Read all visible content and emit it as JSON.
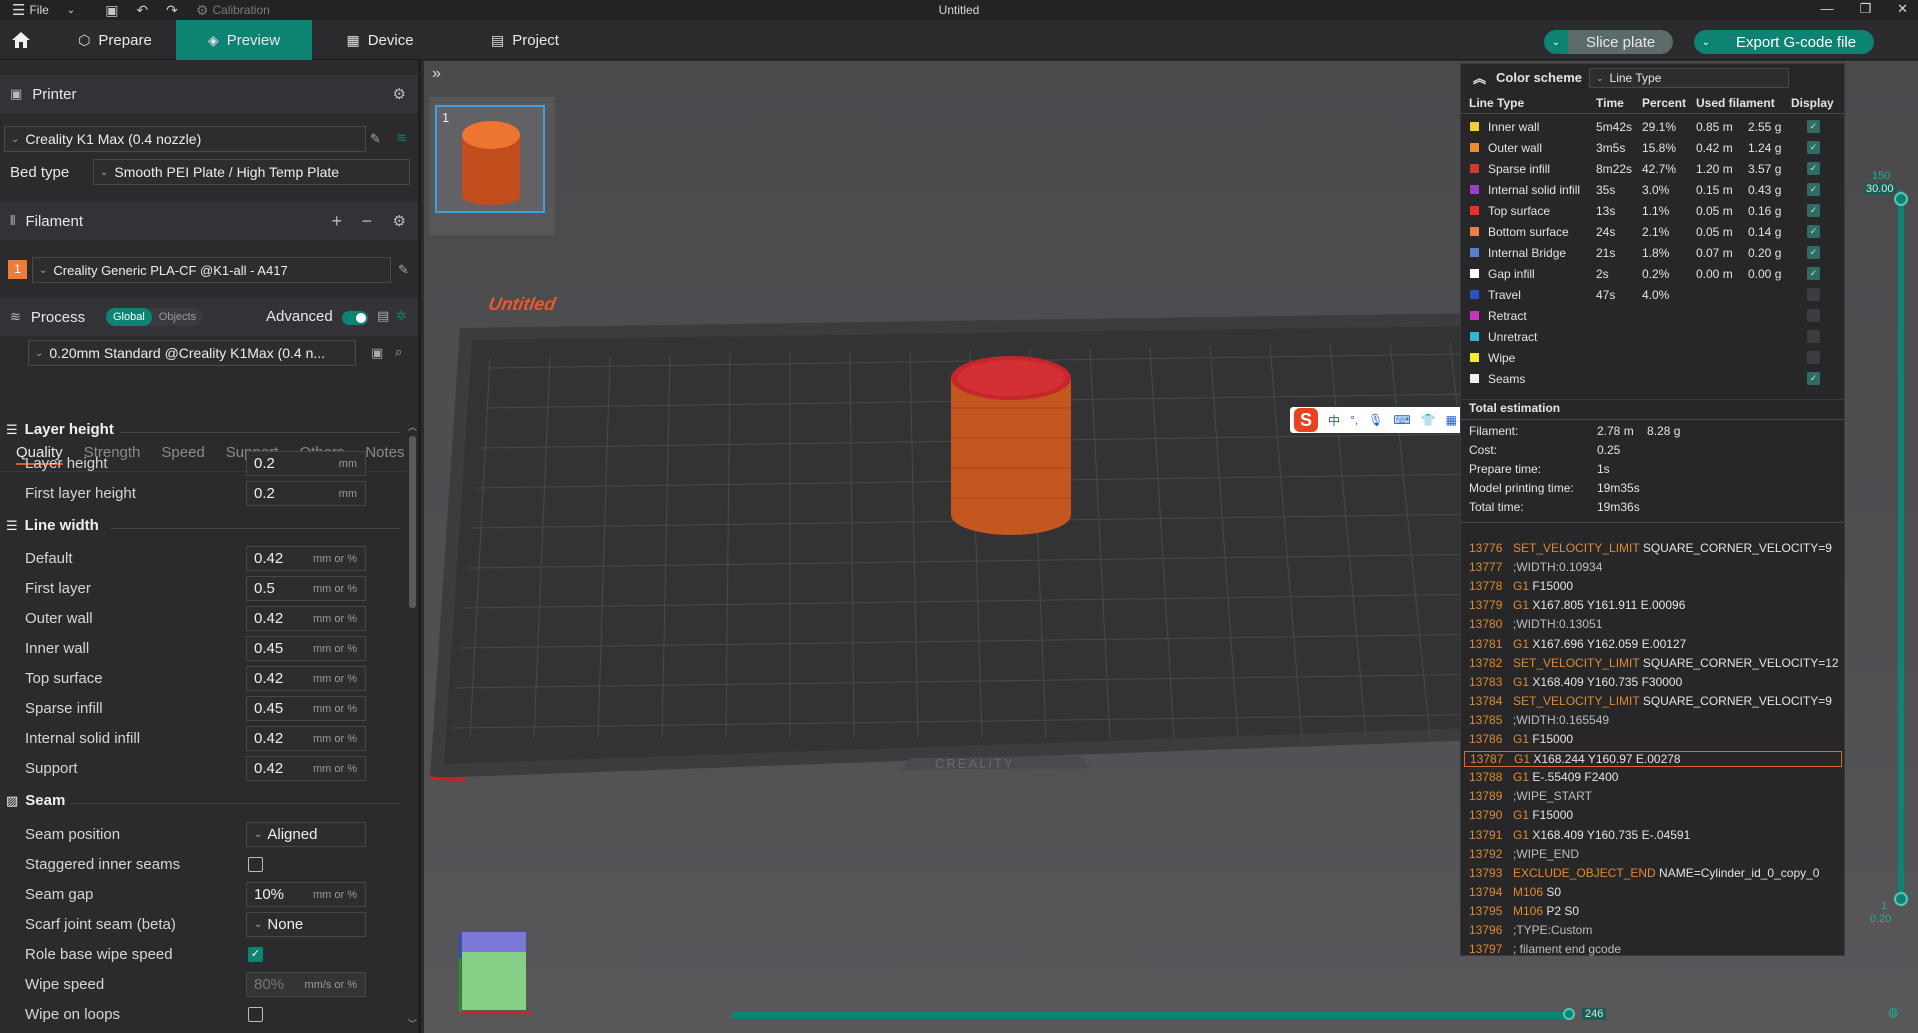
{
  "titlebar": {
    "file_label": "File",
    "calibration_label": "Calibration",
    "title": "Untitled"
  },
  "tabs": {
    "prepare": "Prepare",
    "preview": "Preview",
    "device": "Device",
    "project": "Project"
  },
  "actions": {
    "slice": "Slice plate",
    "export": "Export G-code file"
  },
  "printer": {
    "header": "Printer",
    "name": "Creality K1 Max (0.4 nozzle)",
    "bed_label": "Bed type",
    "bed_value": "Smooth PEI Plate / High Temp Plate"
  },
  "filament": {
    "header": "Filament",
    "slot": "1",
    "name": "Creality Generic PLA-CF @K1-all - A417"
  },
  "process": {
    "header": "Process",
    "global": "Global",
    "objects": "Objects",
    "advanced": "Advanced",
    "profile": "0.20mm Standard @Creality K1Max (0.4 n..."
  },
  "ptabs": [
    "Quality",
    "Strength",
    "Speed",
    "Support",
    "Others",
    "Notes"
  ],
  "groups": {
    "layer_height": "Layer height",
    "line_width": "Line width",
    "seam": "Seam"
  },
  "options": {
    "layer_height": {
      "label": "Layer height",
      "value": "0.2",
      "unit": "mm"
    },
    "first_layer_height": {
      "label": "First layer height",
      "value": "0.2",
      "unit": "mm"
    },
    "lw_default": {
      "label": "Default",
      "value": "0.42",
      "unit": "mm or %"
    },
    "lw_first": {
      "label": "First layer",
      "value": "0.5",
      "unit": "mm or %"
    },
    "lw_outer": {
      "label": "Outer wall",
      "value": "0.42",
      "unit": "mm or %"
    },
    "lw_inner": {
      "label": "Inner wall",
      "value": "0.45",
      "unit": "mm or %"
    },
    "lw_top": {
      "label": "Top surface",
      "value": "0.42",
      "unit": "mm or %"
    },
    "lw_sparse": {
      "label": "Sparse infill",
      "value": "0.45",
      "unit": "mm or %"
    },
    "lw_internal": {
      "label": "Internal solid infill",
      "value": "0.42",
      "unit": "mm or %"
    },
    "lw_support": {
      "label": "Support",
      "value": "0.42",
      "unit": "mm or %"
    },
    "seam_position": {
      "label": "Seam position",
      "value": "Aligned"
    },
    "staggered": {
      "label": "Staggered inner seams"
    },
    "seam_gap": {
      "label": "Seam gap",
      "value": "10%",
      "unit": "mm or %"
    },
    "scarf": {
      "label": "Scarf joint seam (beta)",
      "value": "None"
    },
    "role_wipe": {
      "label": "Role base wipe speed"
    },
    "wipe_speed": {
      "label": "Wipe speed",
      "value": "80%",
      "unit": "mm/s or %"
    },
    "wipe_loops": {
      "label": "Wipe on loops"
    }
  },
  "viewport": {
    "plate_number": "1",
    "bed_label": "Untitled",
    "brand": "CREALITY",
    "layer_top": "150",
    "layer_top_height": "30.00",
    "layer_bottom": "1",
    "layer_bottom_height": "0.20",
    "move_count": "246",
    "ime_cn": "中"
  },
  "legend": {
    "title": "Color scheme",
    "scheme": "Line Type",
    "columns": [
      "Line Type",
      "Time",
      "Percent",
      "Used filament",
      "Display"
    ],
    "rows": [
      {
        "name": "Inner wall",
        "color": "#f2d12e",
        "time": "5m42s",
        "percent": "29.1%",
        "len": "0.85 m",
        "weight": "2.55 g",
        "on": true
      },
      {
        "name": "Outer wall",
        "color": "#f08a2a",
        "time": "3m5s",
        "percent": "15.8%",
        "len": "0.42 m",
        "weight": "1.24 g",
        "on": true
      },
      {
        "name": "Sparse infill",
        "color": "#d2382c",
        "time": "8m22s",
        "percent": "42.7%",
        "len": "1.20 m",
        "weight": "3.57 g",
        "on": true
      },
      {
        "name": "Internal solid infill",
        "color": "#9a3fc8",
        "time": "35s",
        "percent": "3.0%",
        "len": "0.15 m",
        "weight": "0.43 g",
        "on": true
      },
      {
        "name": "Top surface",
        "color": "#e83030",
        "time": "13s",
        "percent": "1.1%",
        "len": "0.05 m",
        "weight": "0.16 g",
        "on": true
      },
      {
        "name": "Bottom surface",
        "color": "#f07c48",
        "time": "24s",
        "percent": "2.1%",
        "len": "0.05 m",
        "weight": "0.14 g",
        "on": true
      },
      {
        "name": "Internal Bridge",
        "color": "#5a80c8",
        "time": "21s",
        "percent": "1.8%",
        "len": "0.07 m",
        "weight": "0.20 g",
        "on": true
      },
      {
        "name": "Gap infill",
        "color": "#ffffff",
        "time": "2s",
        "percent": "0.2%",
        "len": "0.00 m",
        "weight": "0.00 g",
        "on": true
      },
      {
        "name": "Travel",
        "color": "#2a52c8",
        "time": "47s",
        "percent": "4.0%",
        "len": "",
        "weight": "",
        "on": false
      },
      {
        "name": "Retract",
        "color": "#d030c0",
        "time": "",
        "percent": "",
        "len": "",
        "weight": "",
        "on": false
      },
      {
        "name": "Unretract",
        "color": "#30b8d0",
        "time": "",
        "percent": "",
        "len": "",
        "weight": "",
        "on": false
      },
      {
        "name": "Wipe",
        "color": "#f0f028",
        "time": "",
        "percent": "",
        "len": "",
        "weight": "",
        "on": false
      },
      {
        "name": "Seams",
        "color": "#f2f2f2",
        "time": "",
        "percent": "",
        "len": "",
        "weight": "",
        "on": true
      }
    ],
    "total_title": "Total estimation",
    "totals": [
      {
        "label": "Filament:",
        "value": "2.78 m    8.28 g"
      },
      {
        "label": "Cost:",
        "value": "0.25"
      },
      {
        "label": "Prepare time:",
        "value": "1s"
      },
      {
        "label": "Model printing time:",
        "value": "19m35s"
      },
      {
        "label": "Total time:",
        "value": "19m36s"
      }
    ],
    "gcode": [
      {
        "ln": "13776",
        "cmd": "SET_VELOCITY_LIMIT",
        "rest": " SQUARE_CORNER_VELOCITY=9"
      },
      {
        "ln": "13777",
        "cmd": "",
        "rest": ";WIDTH:0.10934"
      },
      {
        "ln": "13778",
        "cmd": "G1",
        "rest": " F15000"
      },
      {
        "ln": "13779",
        "cmd": "G1",
        "rest": " X167.805 Y161.911 E.00096"
      },
      {
        "ln": "13780",
        "cmd": "",
        "rest": ";WIDTH:0.13051"
      },
      {
        "ln": "13781",
        "cmd": "G1",
        "rest": " X167.696 Y162.059 E.00127"
      },
      {
        "ln": "13782",
        "cmd": "SET_VELOCITY_LIMIT",
        "rest": " SQUARE_CORNER_VELOCITY=12"
      },
      {
        "ln": "13783",
        "cmd": "G1",
        "rest": " X168.409 Y160.735 F30000"
      },
      {
        "ln": "13784",
        "cmd": "SET_VELOCITY_LIMIT",
        "rest": " SQUARE_CORNER_VELOCITY=9"
      },
      {
        "ln": "13785",
        "cmd": "",
        "rest": ";WIDTH:0.165549"
      },
      {
        "ln": "13786",
        "cmd": "G1",
        "rest": " F15000"
      },
      {
        "ln": "13787",
        "cmd": "G1",
        "rest": " X168.244 Y160.97 E.00278"
      },
      {
        "ln": "13788",
        "cmd": "G1",
        "rest": " E-.55409 F2400"
      },
      {
        "ln": "13789",
        "cmd": "",
        "rest": ";WIPE_START"
      },
      {
        "ln": "13790",
        "cmd": "G1",
        "rest": " F15000"
      },
      {
        "ln": "13791",
        "cmd": "G1",
        "rest": " X168.409 Y160.735 E-.04591"
      },
      {
        "ln": "13792",
        "cmd": "",
        "rest": ";WIPE_END"
      },
      {
        "ln": "13793",
        "cmd": "EXCLUDE_OBJECT_END",
        "rest": " NAME=Cylinder_id_0_copy_0"
      },
      {
        "ln": "13794",
        "cmd": "M106",
        "rest": " S0"
      },
      {
        "ln": "13795",
        "cmd": "M106",
        "rest": " P2 S0"
      },
      {
        "ln": "13796",
        "cmd": "",
        "rest": ";TYPE:Custom"
      },
      {
        "ln": "13797",
        "cmd": "",
        "rest": "; filament end gcode"
      }
    ]
  },
  "colors": {
    "accent": "#0d8374",
    "highlight": "#d86b2a"
  }
}
